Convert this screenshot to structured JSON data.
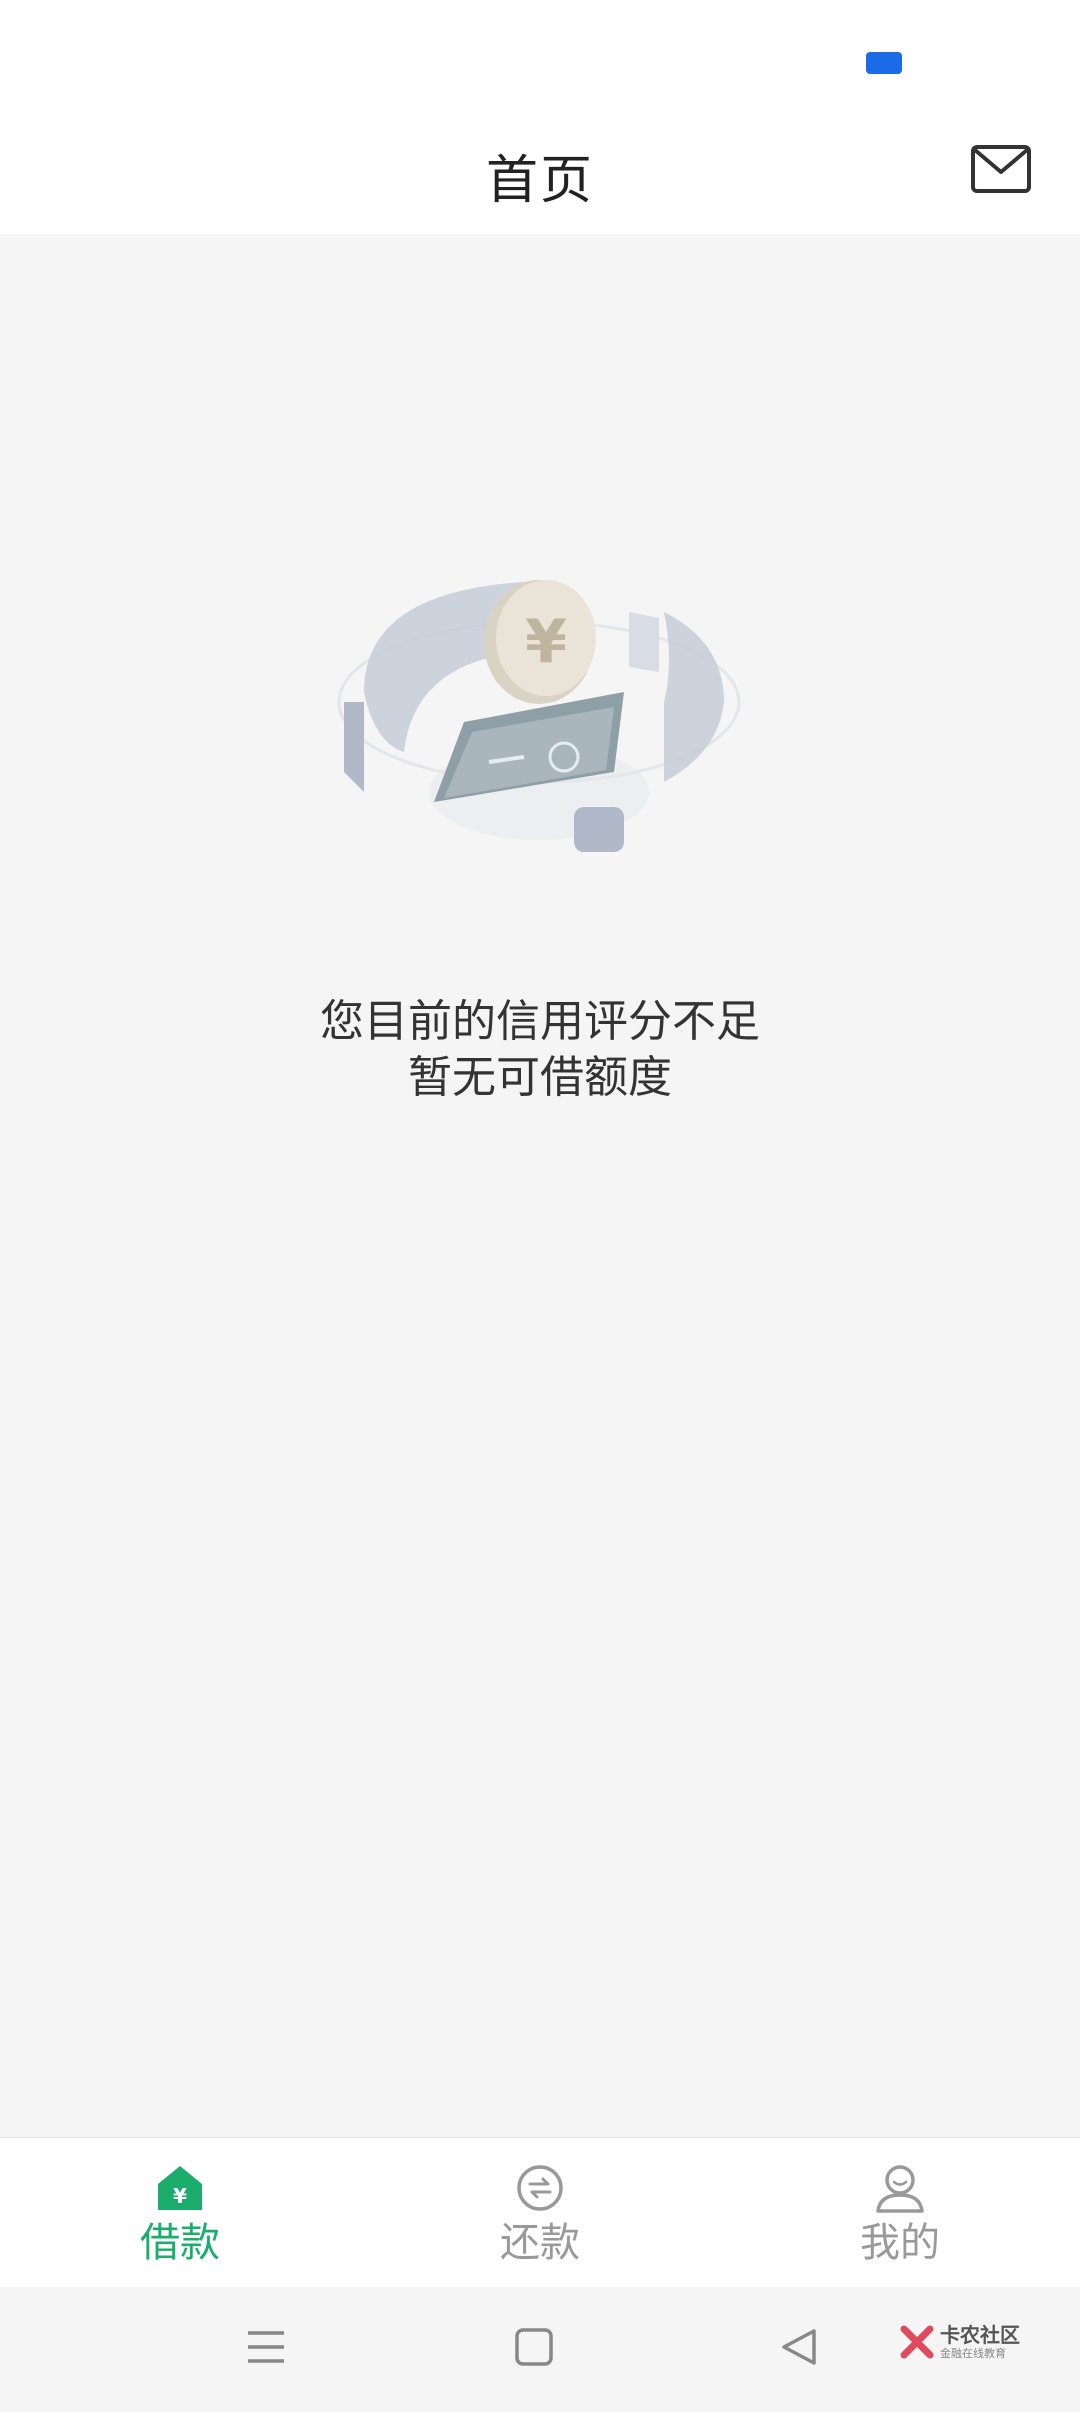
{
  "header": {
    "title": "首页",
    "mail_icon": "mail-icon"
  },
  "empty_state": {
    "illustration": "coin-card-illustration",
    "line1": "您目前的信用评分不足",
    "line2": "暂无可借额度"
  },
  "tabs": [
    {
      "label": "借款",
      "icon": "loan-home-icon",
      "active": true
    },
    {
      "label": "还款",
      "icon": "repay-exchange-icon",
      "active": false
    },
    {
      "label": "我的",
      "icon": "profile-icon",
      "active": false
    }
  ],
  "system_nav": {
    "menu_icon": "menu-icon",
    "home_icon": "home-square-icon",
    "back_icon": "back-triangle-icon"
  },
  "watermark": {
    "title": "卡农社区",
    "subtitle": "金融在线教育"
  },
  "colors": {
    "accent": "#1aad6b",
    "inactive": "#999999",
    "background": "#f5f5f5",
    "status_chip": "#1a6be6"
  }
}
